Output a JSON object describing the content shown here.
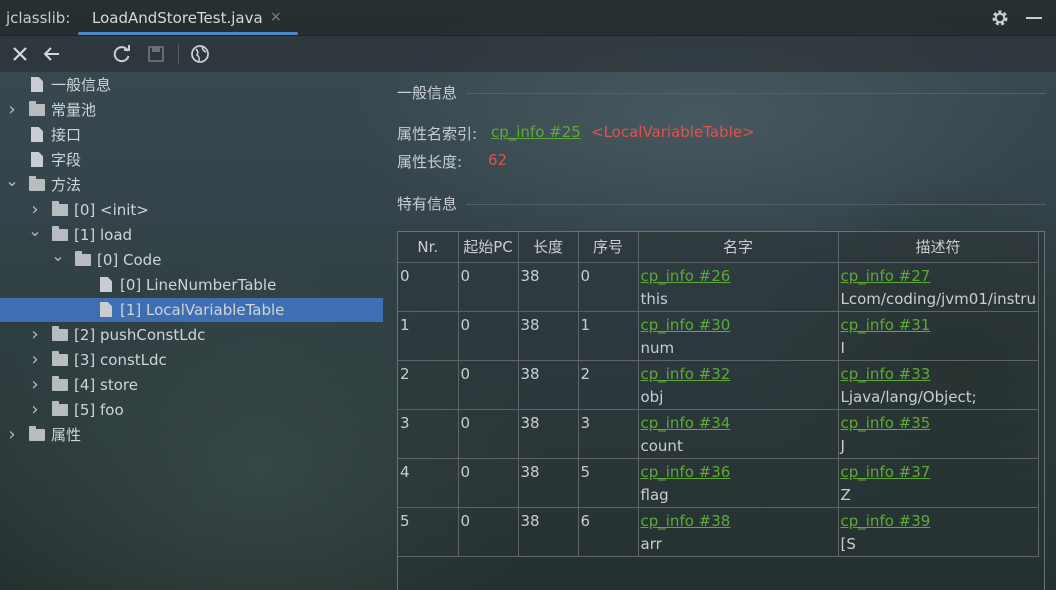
{
  "titlebar": {
    "app_name": "jclasslib:",
    "tab_title": "LoadAndStoreTest.java",
    "tab_close": "×"
  },
  "toolbar": {
    "close_icon": "close-icon",
    "back_icon": "back-arrow-icon",
    "refresh_icon": "refresh-icon",
    "save_icon": "save-icon",
    "web_icon": "globe-icon"
  },
  "tree": {
    "items": [
      {
        "label": "一般信息",
        "type": "file",
        "depth": 0,
        "expanded": null
      },
      {
        "label": "常量池",
        "type": "folder",
        "depth": 0,
        "expanded": false
      },
      {
        "label": "接口",
        "type": "file",
        "depth": 0,
        "expanded": null
      },
      {
        "label": "字段",
        "type": "file",
        "depth": 0,
        "expanded": null
      },
      {
        "label": "方法",
        "type": "folder",
        "depth": 0,
        "expanded": true
      },
      {
        "label": "[0] <init>",
        "type": "folder",
        "depth": 1,
        "expanded": false
      },
      {
        "label": "[1] load",
        "type": "folder",
        "depth": 1,
        "expanded": true
      },
      {
        "label": "[0] Code",
        "type": "folder",
        "depth": 2,
        "expanded": true
      },
      {
        "label": "[0] LineNumberTable",
        "type": "file",
        "depth": 3,
        "expanded": null
      },
      {
        "label": "[1] LocalVariableTable",
        "type": "file",
        "depth": 3,
        "expanded": null,
        "selected": true
      },
      {
        "label": "[2] pushConstLdc",
        "type": "folder",
        "depth": 1,
        "expanded": false
      },
      {
        "label": "[3] constLdc",
        "type": "folder",
        "depth": 1,
        "expanded": false
      },
      {
        "label": "[4] store",
        "type": "folder",
        "depth": 1,
        "expanded": false
      },
      {
        "label": "[5] foo",
        "type": "folder",
        "depth": 1,
        "expanded": false
      },
      {
        "label": "属性",
        "type": "folder",
        "depth": 0,
        "expanded": false
      }
    ]
  },
  "general": {
    "title": "一般信息",
    "attr_name_index_label": "属性名索引:",
    "attr_name_index_link": "cp_info #25",
    "attr_name_index_value": "<LocalVariableTable>",
    "attr_length_label": "属性长度:",
    "attr_length_value": "62"
  },
  "specific": {
    "title": "特有信息",
    "columns": [
      "Nr.",
      "起始PC",
      "长度",
      "序号",
      "名字",
      "描述符"
    ],
    "rows": [
      {
        "nr": "0",
        "start_pc": "0",
        "length": "38",
        "index": "0",
        "name_link": "cp_info #26",
        "name": "this",
        "desc_link": "cp_info #27",
        "desc": "Lcom/coding/jvm01/instru"
      },
      {
        "nr": "1",
        "start_pc": "0",
        "length": "38",
        "index": "1",
        "name_link": "cp_info #30",
        "name": "num",
        "desc_link": "cp_info #31",
        "desc": "I"
      },
      {
        "nr": "2",
        "start_pc": "0",
        "length": "38",
        "index": "2",
        "name_link": "cp_info #32",
        "name": "obj",
        "desc_link": "cp_info #33",
        "desc": "Ljava/lang/Object;"
      },
      {
        "nr": "3",
        "start_pc": "0",
        "length": "38",
        "index": "3",
        "name_link": "cp_info #34",
        "name": "count",
        "desc_link": "cp_info #35",
        "desc": "J"
      },
      {
        "nr": "4",
        "start_pc": "0",
        "length": "38",
        "index": "5",
        "name_link": "cp_info #36",
        "name": "flag",
        "desc_link": "cp_info #37",
        "desc": "Z"
      },
      {
        "nr": "5",
        "start_pc": "0",
        "length": "38",
        "index": "6",
        "name_link": "cp_info #38",
        "name": "arr",
        "desc_link": "cp_info #39",
        "desc": "[S"
      }
    ]
  },
  "colors": {
    "link": "#5fa83a",
    "value_red": "#e0524f",
    "selection": "#3f6fb2",
    "tab_underline": "#4a88c7"
  }
}
